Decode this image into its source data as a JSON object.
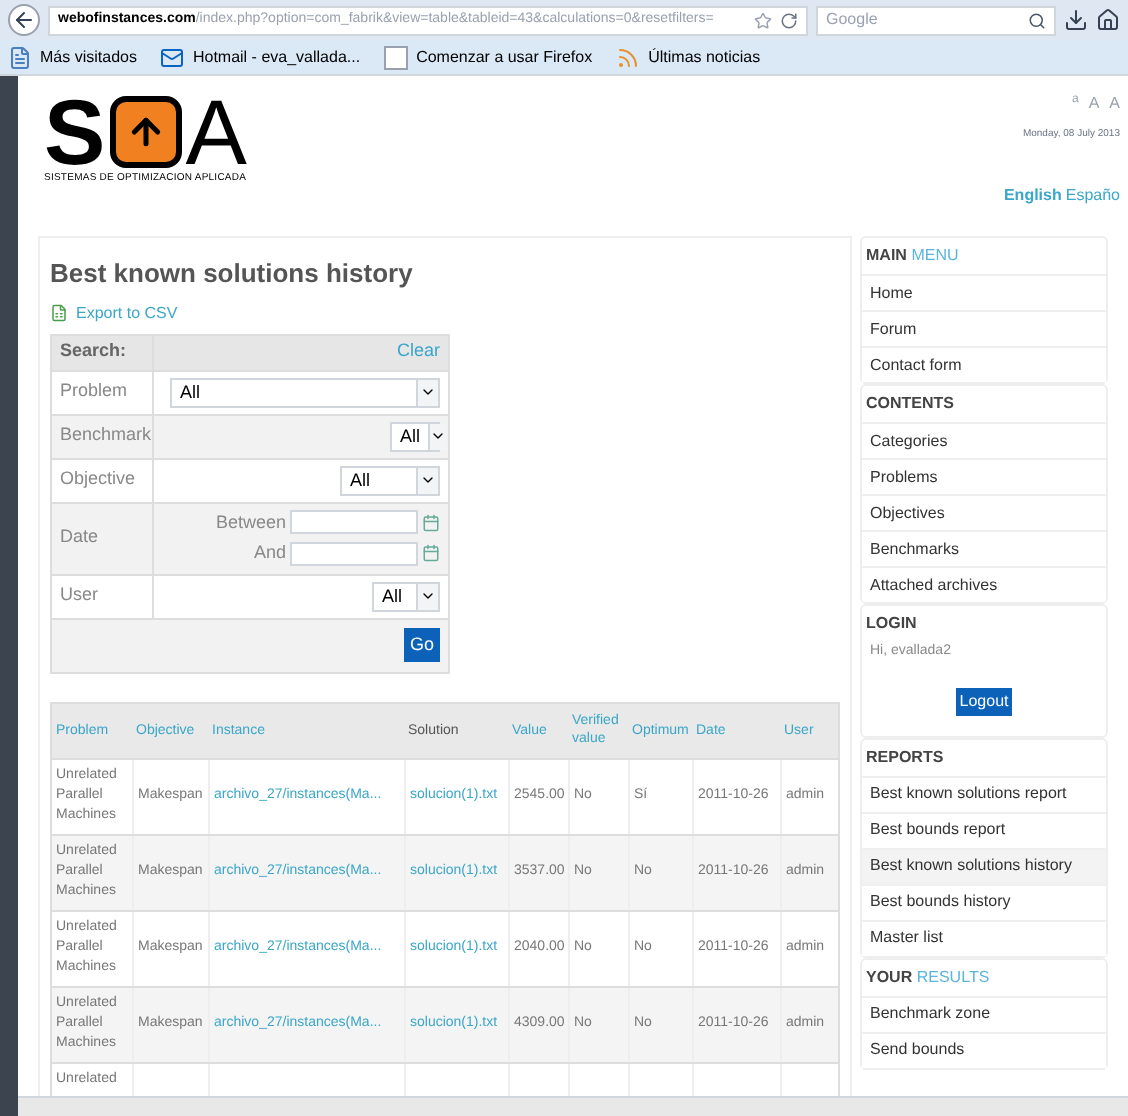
{
  "browser": {
    "url_host": "webofinstances.com",
    "url_path": "/index.php?option=com_fabrik&view=table&tableid=43&calculations=0&resetfilters=",
    "search_placeholder": "Google",
    "bookmarks": [
      {
        "kind": "folder",
        "label": "Más visitados"
      },
      {
        "kind": "mail",
        "label": "Hotmail - eva_vallada..."
      },
      {
        "kind": "page",
        "label": "Comenzar a usar Firefox"
      },
      {
        "kind": "feed",
        "label": "Últimas noticias"
      }
    ]
  },
  "header": {
    "logo_letters": [
      "S",
      "A"
    ],
    "logo_tagline": "SISTEMAS DE OPTIMIZACION APLICADA",
    "font_sizes": [
      "a",
      "A",
      "A"
    ],
    "date": "Monday, 08 July 2013",
    "languages": [
      {
        "label": "English",
        "selected": true
      },
      {
        "label": "Españo",
        "selected": false
      }
    ]
  },
  "main": {
    "title": "Best known solutions history",
    "export": "Export to CSV",
    "search": {
      "heading": "Search:",
      "clear": "Clear",
      "go": "Go",
      "filters": [
        {
          "kind": "select",
          "label": "Problem",
          "value": "All"
        },
        {
          "kind": "select",
          "label": "Benchmark",
          "value": "All"
        },
        {
          "kind": "select",
          "label": "Objective",
          "value": "All"
        },
        {
          "kind": "range",
          "label": "Date",
          "from_label": "Between",
          "to_label": "And"
        },
        {
          "kind": "select",
          "label": "User",
          "value": "All"
        }
      ]
    },
    "table": {
      "columns": [
        {
          "label": "Problem",
          "link": true
        },
        {
          "label": "Objective",
          "link": true
        },
        {
          "label": "Instance",
          "link": true
        },
        {
          "label": "Solution",
          "link": false
        },
        {
          "label": "Value",
          "link": true
        },
        {
          "label": "Verified value",
          "link": true
        },
        {
          "label": "Optimum",
          "link": true
        },
        {
          "label": "Date",
          "link": true
        },
        {
          "label": "User",
          "link": true
        }
      ],
      "rows": [
        {
          "problem": "Unrelated Parallel Machines",
          "objective": "Makespan",
          "instance": "archivo_27/instances(Ma...",
          "solution": "solucion(1).txt",
          "value": "2545.00",
          "verified": "No",
          "optimum": "Sí",
          "date": "2011-10-26",
          "user": "admin"
        },
        {
          "problem": "Unrelated Parallel Machines",
          "objective": "Makespan",
          "instance": "archivo_27/instances(Ma...",
          "solution": "solucion(1).txt",
          "value": "3537.00",
          "verified": "No",
          "optimum": "No",
          "date": "2011-10-26",
          "user": "admin"
        },
        {
          "problem": "Unrelated Parallel Machines",
          "objective": "Makespan",
          "instance": "archivo_27/instances(Ma...",
          "solution": "solucion(1).txt",
          "value": "2040.00",
          "verified": "No",
          "optimum": "No",
          "date": "2011-10-26",
          "user": "admin"
        },
        {
          "problem": "Unrelated Parallel Machines",
          "objective": "Makespan",
          "instance": "archivo_27/instances(Ma...",
          "solution": "solucion(1).txt",
          "value": "4309.00",
          "verified": "No",
          "optimum": "No",
          "date": "2011-10-26",
          "user": "admin"
        },
        {
          "problem": "Unrelated"
        }
      ]
    }
  },
  "sidebar": [
    {
      "kind": "menu",
      "title": "MAIN",
      "title_accent": "MENU",
      "items": [
        {
          "label": "Home",
          "selected": false
        },
        {
          "label": "Forum",
          "selected": false
        },
        {
          "label": "Contact form",
          "selected": false
        }
      ]
    },
    {
      "kind": "menu",
      "title": "CONTENTS",
      "items": [
        {
          "label": "Categories",
          "selected": false
        },
        {
          "label": "Problems",
          "selected": false
        },
        {
          "label": "Objectives",
          "selected": false
        },
        {
          "label": "Benchmarks",
          "selected": false
        },
        {
          "label": "Attached archives",
          "selected": false
        }
      ]
    },
    {
      "kind": "login",
      "title": "LOGIN",
      "greeting": "Hi, evallada2",
      "button": "Logout"
    },
    {
      "kind": "menu",
      "title": "REPORTS",
      "items": [
        {
          "label": "Best known solutions report",
          "selected": false
        },
        {
          "label": "Best bounds report",
          "selected": false
        },
        {
          "label": "Best known solutions history",
          "selected": true
        },
        {
          "label": "Best bounds history",
          "selected": false
        },
        {
          "label": "Master list",
          "selected": false
        }
      ]
    },
    {
      "kind": "menu",
      "title": "YOUR",
      "title_accent": "RESULTS",
      "items": [
        {
          "label": "Benchmark zone",
          "selected": false
        },
        {
          "label": "Send bounds",
          "selected": false
        }
      ]
    }
  ]
}
